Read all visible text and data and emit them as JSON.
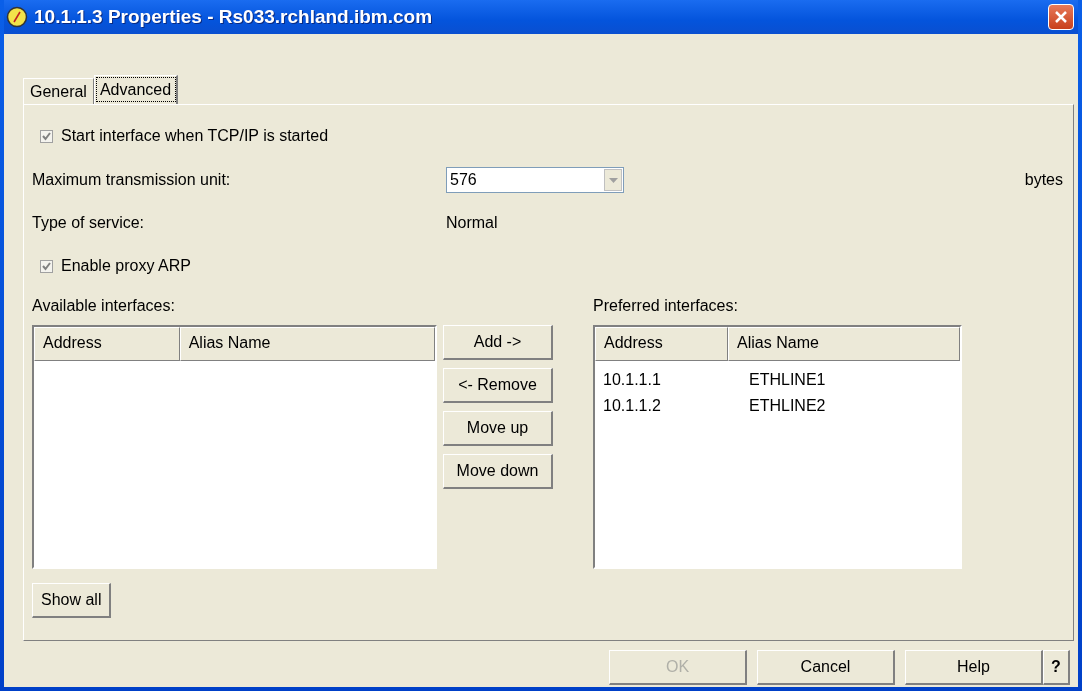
{
  "window": {
    "title": "10.1.1.3 Properties - Rs033.rchland.ibm.com"
  },
  "tabs": [
    {
      "label": "General",
      "selected": false
    },
    {
      "label": "Advanced",
      "selected": true
    }
  ],
  "start_interface": {
    "label": "Start interface when TCP/IP is started",
    "checked": true
  },
  "mtu": {
    "label": "Maximum transmission unit:",
    "value": "576",
    "unit": "bytes"
  },
  "type_of_service": {
    "label": "Type of service:",
    "value": "Normal"
  },
  "proxy_arp": {
    "label": "Enable proxy ARP",
    "checked": true
  },
  "available": {
    "label": "Available interfaces:",
    "columns": [
      "Address",
      "Alias Name"
    ]
  },
  "move_buttons": [
    "Add ->",
    "<- Remove",
    "Move up",
    "Move down"
  ],
  "preferred": {
    "label": "Preferred interfaces:",
    "columns": [
      "Address",
      "Alias Name"
    ],
    "rows": [
      [
        "10.1.1.1",
        "ETHLINE1"
      ],
      [
        "10.1.1.2",
        "ETHLINE2"
      ]
    ]
  },
  "show_all": "Show all",
  "buttons": [
    {
      "label": "OK",
      "disabled": true
    },
    {
      "label": "Cancel",
      "disabled": false
    },
    {
      "label": "Help",
      "disabled": false
    },
    {
      "label": "?",
      "disabled": false
    }
  ]
}
